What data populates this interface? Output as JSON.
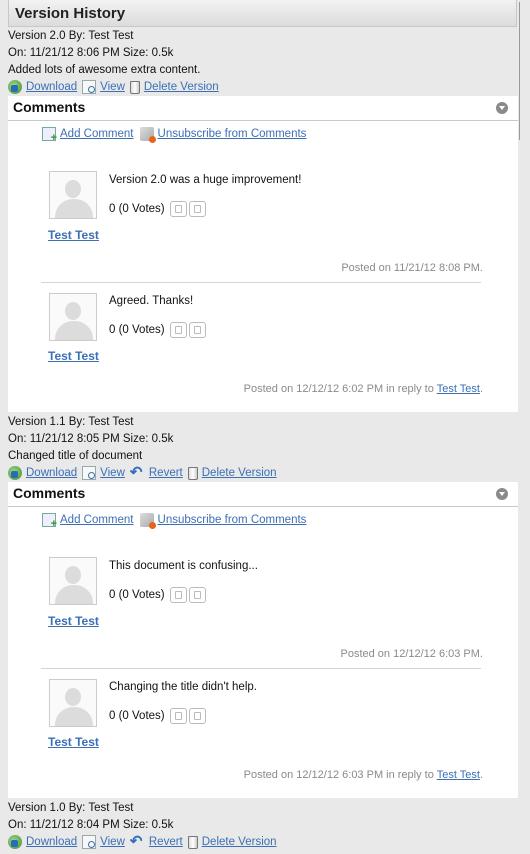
{
  "header": {
    "title": "Version History"
  },
  "actions": {
    "download": "Download",
    "view": "View",
    "revert": "Revert",
    "delete": "Delete Version"
  },
  "comments_panel": {
    "title": "Comments",
    "add_comment": "Add Comment",
    "unsubscribe": "Unsubscribe from Comments"
  },
  "versions": [
    {
      "by": "Version 2.0 By: Test Test",
      "on": "On: 11/21/12 8:06 PM Size: 0.5k",
      "desc": "Added lots of awesome extra content.",
      "comments": [
        {
          "author": "Test Test",
          "text": "Version 2.0 was a huge improvement!",
          "votes": "0 (0 Votes)",
          "posted": "Posted on 11/21/12 8:08 PM."
        },
        {
          "author": "Test Test",
          "text": "Agreed. Thanks!",
          "votes": "0 (0 Votes)",
          "posted": "Posted on 12/12/12 6:02 PM in reply to ",
          "reply_to": "Test Test"
        }
      ]
    },
    {
      "by": "Version 1.1 By: Test Test",
      "on": "On: 11/21/12 8:05 PM Size: 0.5k",
      "desc": "Changed title of document",
      "comments": [
        {
          "author": "Test Test",
          "text": "This document is confusing...",
          "votes": "0 (0 Votes)",
          "posted": "Posted on 12/12/12 6:03 PM."
        },
        {
          "author": "Test Test",
          "text": "Changing the title didn't help.",
          "votes": "0 (0 Votes)",
          "posted": "Posted on 12/12/12 6:03 PM in reply to ",
          "reply_to": "Test Test"
        }
      ]
    },
    {
      "by": "Version 1.0 By: Test Test",
      "on": "On: 11/21/12 8:04 PM Size: 0.5k"
    }
  ]
}
